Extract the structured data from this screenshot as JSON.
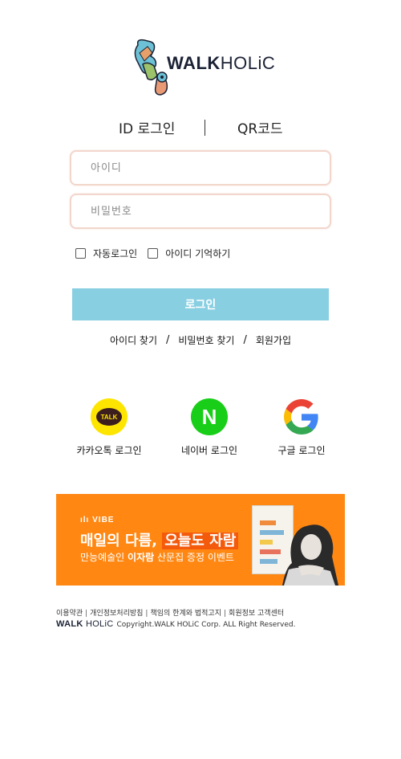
{
  "logo": {
    "text_bold": "WALK",
    "text_regular": "HOLiC"
  },
  "tabs": [
    {
      "label": "ID 로그인"
    },
    {
      "label": "QR코드"
    }
  ],
  "form": {
    "id_placeholder": "아이디",
    "pw_placeholder": "비밀번호",
    "auto_login_label": "자동로그인",
    "remember_id_label": "아이디 기억하기",
    "login_button": "로그인"
  },
  "links": {
    "find_id": "아이디 찾기",
    "find_pw": "비밀번호 찾기",
    "signup": "회원가입",
    "separator": "/"
  },
  "social": [
    {
      "label": "카카오톡 로그인",
      "icon": "kakao-talk-icon",
      "icon_text": "TALK",
      "color": "#FEE500"
    },
    {
      "label": "네이버 로그인",
      "icon": "naver-icon",
      "icon_text": "N",
      "color": "#19CE18"
    },
    {
      "label": "구글 로그인",
      "icon": "google-icon",
      "color": "#4285F4"
    }
  ],
  "banner": {
    "brand": "VIBE",
    "headline_part1": "매일의 다름,",
    "headline_part2": "오늘도 자람",
    "sub_part1": "만능예술인",
    "sub_bold": "이자람",
    "sub_part2": "산문집 증정 이벤트",
    "background_color": "#FF8712"
  },
  "footer": {
    "links": [
      "이용약관",
      "개인정보처리방침",
      "책임의 한계와 법적고지",
      "회원정보 고객센터"
    ],
    "brand_bold": "WALK",
    "brand_regular": "HOLiC",
    "copyright": "Copyright.WALK HOLiC Corp. ALL Right Reserved."
  },
  "colors": {
    "login_button": "#88CFE2",
    "input_border": "#F2D6CC",
    "logo_text": "#1B2235"
  }
}
